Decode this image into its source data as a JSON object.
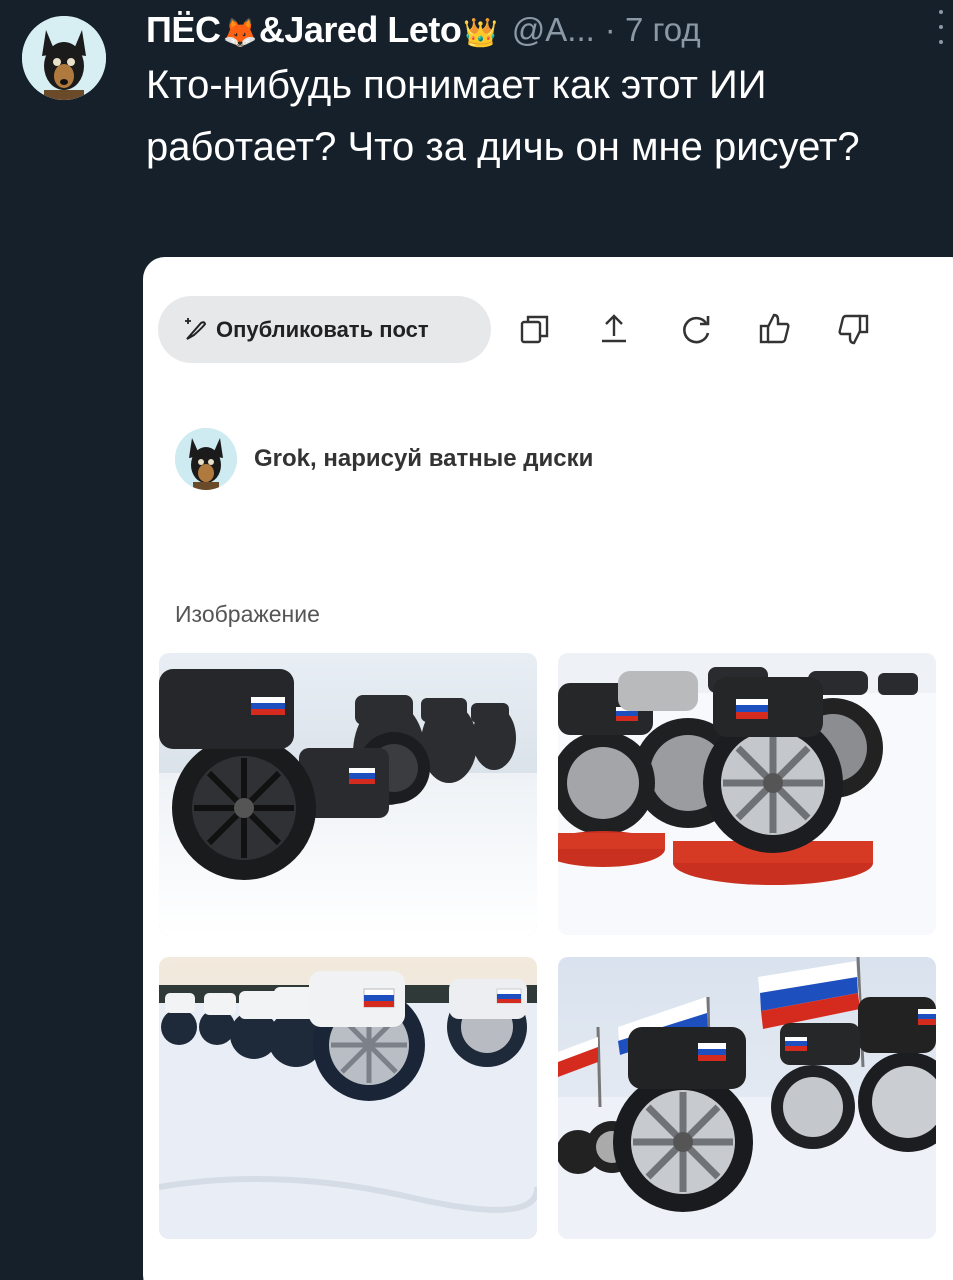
{
  "tweet": {
    "author": "ПЁС",
    "author_emoji_1": "🦊",
    "author_mid": "&Jared Leto",
    "author_emoji_2": "👑",
    "handle": "@A...",
    "time": "· 7 год",
    "text": "Кто-нибудь понимает как этот ИИ работает? Что за дичь он мне рисует?"
  },
  "card": {
    "publish_label": "Опубликовать пост",
    "toolbar_icons": [
      "copy-icon",
      "share-icon",
      "regenerate-icon",
      "thumbs-up-icon",
      "thumbs-down-icon"
    ],
    "prompt": "Grok, нарисуй ватные диски",
    "section_label": "Изображение",
    "images": [
      "generated-image-1",
      "generated-image-2",
      "generated-image-3",
      "generated-image-4"
    ]
  },
  "colors": {
    "background": "#15202b",
    "card": "#ffffff",
    "muted_text": "#8b98a5",
    "flag_white": "#ffffff",
    "flag_blue": "#1d4fbf",
    "flag_red": "#d52b1e"
  }
}
